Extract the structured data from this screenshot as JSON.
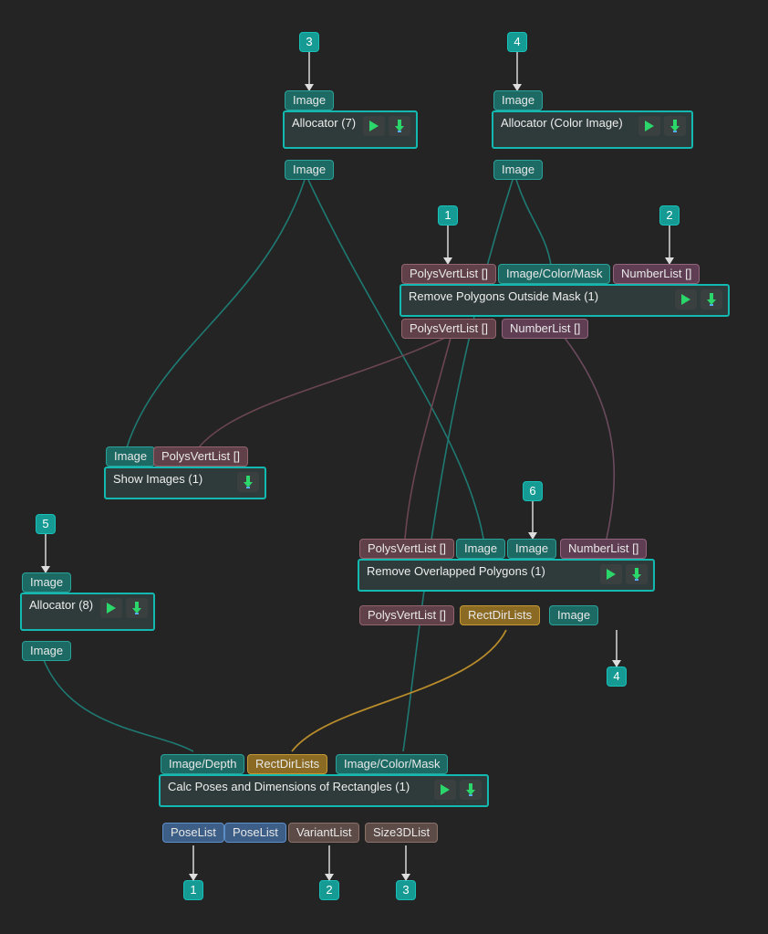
{
  "colors": {
    "background": "#242424",
    "node_border": "#12b9b0",
    "node_bg": "#2f3a3a",
    "port_image": "#1d6a64",
    "port_poly": "#614149",
    "port_num": "#5f3e54",
    "port_rect": "#8b6b24",
    "port_pose": "#3c5e87",
    "port_variant": "#5c4b46",
    "wire_teal": "#1e7a73",
    "wire_maroon": "#6b4650",
    "wire_purple": "#6b4a5d",
    "wire_gold": "#b88c2b",
    "badge_bg": "#159b94"
  },
  "badges": {
    "b3": "3",
    "b4": "4",
    "b1": "1",
    "b2": "2",
    "b5": "5",
    "b6": "6",
    "out4": "4",
    "out1": "1",
    "out2": "2",
    "out3": "3"
  },
  "ports": {
    "image": "Image",
    "polys": "PolysVertList []",
    "image_color_mask": "Image/Color/Mask",
    "numberlist": "NumberList []",
    "rectdir": "RectDirLists",
    "image_depth": "Image/Depth",
    "poselist": "PoseList",
    "variantlist": "VariantList",
    "size3d": "Size3DList"
  },
  "nodes": {
    "alloc7": {
      "title": "Allocator (7)"
    },
    "alloc_color": {
      "title": "Allocator (Color Image)"
    },
    "remove_mask": {
      "title": "Remove Polygons Outside Mask (1)"
    },
    "show_images": {
      "title": "Show Images (1)"
    },
    "alloc8": {
      "title": "Allocator (8)"
    },
    "remove_overlap": {
      "title": "Remove Overlapped Polygons (1)"
    },
    "calc_poses": {
      "title": "Calc Poses and Dimensions of Rectangles (1)"
    }
  }
}
